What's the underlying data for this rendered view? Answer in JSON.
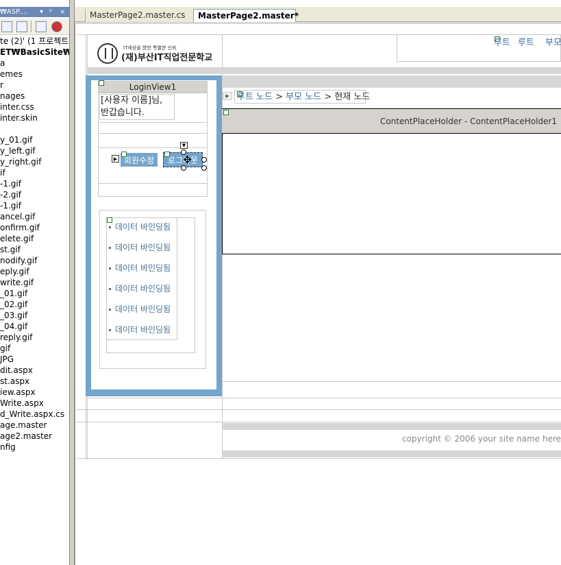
{
  "solution_explorer": {
    "title": "₩ASP....",
    "title_buttons": [
      "▾",
      "ᵖ",
      "×"
    ],
    "items": [
      {
        "label": "te (2)' (1 프로젝트",
        "bold": false
      },
      {
        "label": "ET₩BasicSite₩",
        "bold": true
      },
      {
        "label": "a",
        "bold": false
      },
      {
        "label": "emes",
        "bold": false
      },
      {
        "label": "r",
        "bold": false
      },
      {
        "label": "nages",
        "bold": false
      },
      {
        "label": "inter.css",
        "bold": false
      },
      {
        "label": "inter.skin",
        "bold": false
      },
      {
        "label": "",
        "bold": false
      },
      {
        "label": "y_01.gif",
        "bold": false
      },
      {
        "label": "y_left.gif",
        "bold": false
      },
      {
        "label": "y_right.gif",
        "bold": false
      },
      {
        "label": "if",
        "bold": false
      },
      {
        "label": "-1.gif",
        "bold": false
      },
      {
        "label": "-2.gif",
        "bold": false
      },
      {
        "label": "-1.gif",
        "bold": false
      },
      {
        "label": "ancel.gif",
        "bold": false
      },
      {
        "label": "onfirm.gif",
        "bold": false
      },
      {
        "label": "elete.gif",
        "bold": false
      },
      {
        "label": "st.gif",
        "bold": false
      },
      {
        "label": "nodify.gif",
        "bold": false
      },
      {
        "label": "eply.gif",
        "bold": false
      },
      {
        "label": "write.gif",
        "bold": false
      },
      {
        "label": "_01.gif",
        "bold": false
      },
      {
        "label": "_02.gif",
        "bold": false
      },
      {
        "label": "_03.gif",
        "bold": false
      },
      {
        "label": "_04.gif",
        "bold": false
      },
      {
        "label": "reply.gif",
        "bold": false
      },
      {
        "label": "gif",
        "bold": false
      },
      {
        "label": "JPG",
        "bold": false
      },
      {
        "label": "dit.aspx",
        "bold": false
      },
      {
        "label": "st.aspx",
        "bold": false
      },
      {
        "label": "iew.aspx",
        "bold": false
      },
      {
        "label": "Write.aspx",
        "bold": false
      },
      {
        "label": "d_Write.aspx.cs",
        "bold": false
      },
      {
        "label": "age.master",
        "bold": false
      },
      {
        "label": "age2.master",
        "bold": false
      },
      {
        "label": "nfig",
        "bold": false
      }
    ]
  },
  "tabs": [
    {
      "label": "MasterPage2.master.cs",
      "active": false
    },
    {
      "label": "MasterPage2.master*",
      "active": true
    }
  ],
  "header": {
    "logo_small": "IT세상을 향한 특별한 신뢰",
    "logo_big": "(재)부산IT직업전문학교",
    "nav_links": [
      "루트",
      "루트",
      "부모"
    ]
  },
  "login_view": {
    "title": "LoginView1",
    "message_line1": "[사용자 이름]님,",
    "message_line2": "반갑습니다.",
    "modify_button": "회원수정",
    "logout_button": "로그아웃"
  },
  "menu": {
    "items": [
      "데이터 바인딩됨",
      "데이터 바인딩됨",
      "데이터 바인딩됨",
      "데이터 바인딩됨",
      "데이터 바인딩됨",
      "데이터 바인딩됨"
    ]
  },
  "breadcrumb": {
    "root": "루트 노드",
    "parent": "부모 노드",
    "current": "현재 노드",
    "separator": ">"
  },
  "content_placeholder": {
    "label": "ContentPlaceHolder - ContentPlaceHolder1"
  },
  "footer": {
    "copyright": "copyright © 2006 your site name here"
  },
  "colors": {
    "accent_blue": "#74a5cc",
    "link_blue": "#3a6ea5",
    "title_bar": "#6d88b5"
  }
}
